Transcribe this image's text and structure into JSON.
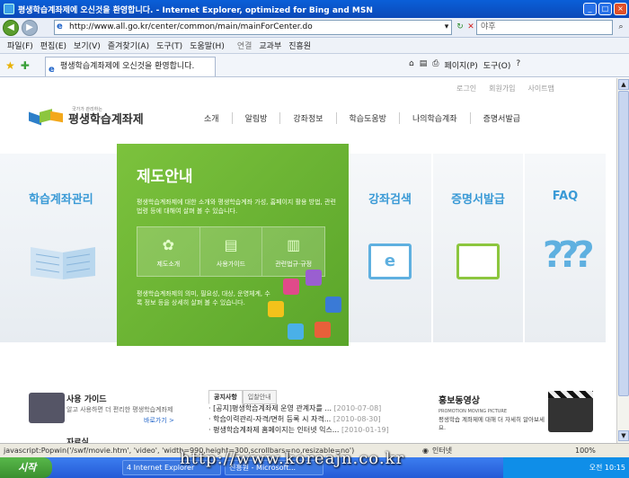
{
  "window": {
    "title": "평생학습계좌제에 오신것을 환영합니다. - Internet Explorer, optimized for Bing and MSN"
  },
  "address": {
    "url": "http://www.all.go.kr/center/common/main/mainForCenter.do",
    "search_value": "야후"
  },
  "menu": [
    "파일(F)",
    "편집(E)",
    "보기(V)",
    "즐겨찾기(A)",
    "도구(T)",
    "도움말(H)"
  ],
  "links": {
    "label": "연결",
    "items": [
      "교과부",
      "진흥원"
    ]
  },
  "tab": {
    "title": "평생학습계좌제에 오신것을 환영합니다."
  },
  "commands": {
    "page": "페이지(P)",
    "tools": "도구(O)"
  },
  "site": {
    "toplinks": [
      "로그인",
      "회원가입",
      "사이트맵"
    ],
    "logo_small": "국가가 관리하는",
    "logo": "평생학습계좌제",
    "gnav": [
      "소개",
      "알림방",
      "강좌정보",
      "학습도움방",
      "나의학습계좌",
      "증명서발급"
    ],
    "hero": {
      "left_title": "학습계좌관리",
      "main_title": "제도안내",
      "main_desc": "평생학습계좌제에 대한 소개와 평생학습계좌 가성, 홈페이지 활용 방법, 관련 법령 등에 대해여 살펴 볼 수 있습니다.",
      "boxes": [
        "제도소개",
        "사용가이드",
        "관련법규·규정"
      ],
      "main_desc2": "평생학습계좌제의 의미, 필요성, 대상, 운영체계, 수록 정보 등을 상세히 살펴 볼 수 있습니다.",
      "search_title": "강좌검색",
      "cert_title": "증명서발급",
      "faq_title": "FAQ",
      "monitor_letter": "e"
    },
    "guide": {
      "title": "사용 가이드",
      "desc": "알고 사용하면 더 편리한 평생학습계좌제",
      "more": "바로가기 >",
      "data_title": "자료실"
    },
    "notice": {
      "tabs": [
        "공지사항",
        "입찰안내"
      ],
      "items": [
        {
          "text": "· [공지]평생학습계좌제 운영 관계자를 ...",
          "date": "[2010-07-08]"
        },
        {
          "text": "· 학습이력관리-자격/면허 등록 시 자격...",
          "date": "[2010-08-30]"
        },
        {
          "text": "· 평생학습계좌제 홈페이지는 인터넷 익스...",
          "date": "[2010-01-19]"
        }
      ]
    },
    "promo": {
      "title": "홍보동영상",
      "sub": "PROMOTION MOVING PICTURE",
      "desc": "평생학습 계좌제에 대해 더 자세히 알아보세요."
    }
  },
  "statusbar": {
    "text": "javascript:Popwin('/swf/movie.htm', 'video', 'width=990,height=300,scrollbars=no,resizable=no')",
    "zone": "인터넷",
    "zoom": "100%"
  },
  "taskbar": {
    "start": "시작",
    "tasks": [
      "4 Internet Explorer",
      "진흥원 - Microsoft..."
    ],
    "clock": "오전 10:15"
  },
  "watermark": "http://www.koreajn.co.kr",
  "colors": {
    "green": "#6cb534",
    "blue": "#3a9ad6",
    "titlebar": "#0b49b8"
  }
}
